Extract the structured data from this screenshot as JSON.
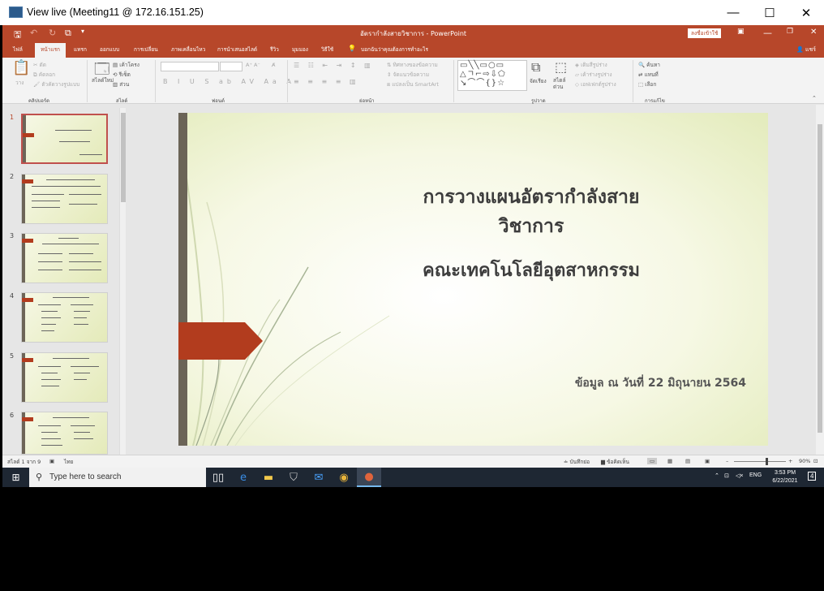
{
  "window": {
    "title": "View live (Meeting11 @ 172.16.151.25)",
    "minimize": "—",
    "maximize": "☐",
    "close": "✕"
  },
  "ppt": {
    "doc_title": "อัตรากำลังสายวิชาการ - PowerPoint",
    "signin": "ลงชื่อเข้าใช้",
    "share": "แชร์",
    "tabs": [
      "ไฟล์",
      "หน้าแรก",
      "แทรก",
      "ออกแบบ",
      "การเปลี่ยน",
      "ภาพเคลื่อนไหว",
      "การนำเสนอสไลด์",
      "รีวิว",
      "มุมมอง",
      "วิธีใช้"
    ],
    "tell_me": "บอกฉันว่าคุณต้องการทำอะไร",
    "ribbon": {
      "paste": "วาง",
      "cut": "ตัด",
      "copy": "คัดลอก",
      "format_painter": "ตัวคัดวางรูปแบบ",
      "clipboard": "คลิปบอร์ด",
      "new_slide": "สไลด์ใหม่",
      "layout": "เค้าโครง",
      "reset": "รีเซ็ต",
      "section": "ส่วน",
      "slides": "สไลด์",
      "font": "ฟอนต์",
      "text_direction": "ทิศทางของข้อความ",
      "align_text": "จัดแนวข้อความ",
      "smartart": "แปลงเป็น SmartArt",
      "paragraph": "ย่อหน้า",
      "arrange": "จัดเรียง",
      "quick_styles": "สไตล์ด่วน",
      "shape_fill": "เติมสีรูปร่าง",
      "shape_outline": "เค้าร่างรูปร่าง",
      "shape_effects": "เอฟเฟกต์รูปร่าง",
      "drawing": "รูปวาด",
      "find": "ค้นหา",
      "replace": "แทนที่",
      "select": "เลือก",
      "editing": "การแก้ไข"
    },
    "thumbnails": [
      "1",
      "2",
      "3",
      "4",
      "5",
      "6"
    ],
    "slide": {
      "title1": "การวางแผนอัตรากำลังสายวิชาการ",
      "title2": "คณะเทคโนโลยีอุตสาหกรรม",
      "subtitle": "ข้อมูล ณ วันที่ 22 มิถุนายน 2564"
    },
    "status": {
      "slide_count": "สไลด์ 1 จาก 9",
      "language": "ไทย",
      "notes": "บันทึกย่อ",
      "comments": "ข้อคิดเห็น",
      "zoom": "90%",
      "zoom_level": 0.62
    }
  },
  "taskbar": {
    "search_placeholder": "Type here to search",
    "lang": "ENG",
    "time": "3:53 PM",
    "date": "6/22/2021",
    "notif_count": "4"
  }
}
